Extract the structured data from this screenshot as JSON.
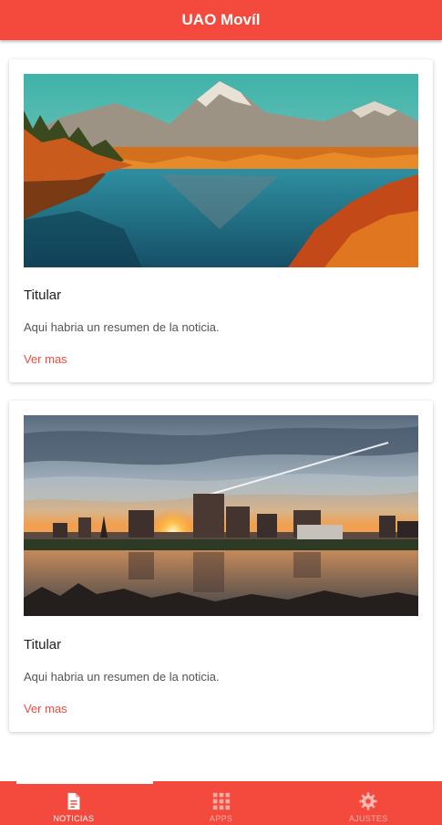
{
  "app": {
    "title": "UAO Movíl"
  },
  "cards": [
    {
      "image": "mountain-lake-autumn-image",
      "title": "Titular",
      "summary": "Aqui habria un resumen de la noticia.",
      "link": "Ver mas"
    },
    {
      "image": "city-skyline-sunset-image",
      "title": "Titular",
      "summary": "Aqui habria un resumen de la noticia.",
      "link": "Ver mas"
    }
  ],
  "tabs": [
    {
      "label": "NOTICIAS",
      "icon": "document-icon",
      "active": true
    },
    {
      "label": "APPS",
      "icon": "grid-icon",
      "active": false
    },
    {
      "label": "AJUSTES",
      "icon": "gear-icon",
      "active": false
    }
  ],
  "colors": {
    "primary": "#f44a3d",
    "link": "#f44a3d"
  }
}
